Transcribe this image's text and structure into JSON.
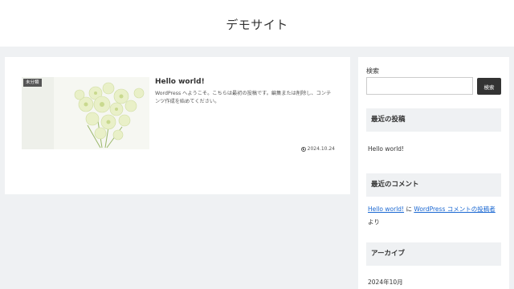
{
  "header": {
    "site_title": "デモサイト"
  },
  "post": {
    "category": "未分類",
    "title": "Hello world!",
    "excerpt": "WordPress へようこそ。こちらは最初の投稿です。編集または削除し、コンテンツ作成を始めてください。",
    "date": "2024.10.24",
    "thumbnail_icon": "flower-bouquet-image"
  },
  "sidebar": {
    "search_label": "検索",
    "search_placeholder": "",
    "search_button": "検索",
    "recent_posts_heading": "最近の投稿",
    "recent_posts": [
      "Hello world!"
    ],
    "recent_comments_heading": "最近のコメント",
    "recent_comment": {
      "post_link": "Hello world!",
      "connector": " に ",
      "author_link": "WordPress コメントの投稿者",
      "suffix": " より"
    },
    "archive_heading": "アーカイブ",
    "archives": [
      "2024年10月"
    ]
  },
  "colors": {
    "accent_link": "#1967d2",
    "button_bg": "#333333",
    "page_bg": "#eff1f3"
  }
}
